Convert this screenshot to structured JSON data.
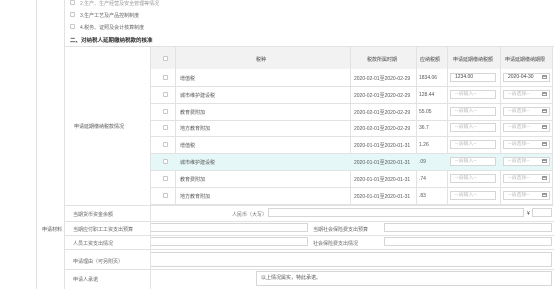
{
  "checklist": [
    {
      "label": "2.生产、生产经营及安全管理等情况",
      "checked": false
    },
    {
      "label": "3.生产工艺及产品控制制度",
      "checked": false
    },
    {
      "label": "4.税务、证照及会计核算制度",
      "checked": false
    }
  ],
  "section2_title": "二、对纳税人延期缴纳税款的核准",
  "apply_label": "申请延期缴纳税款情况",
  "table_headers": {
    "tax_item": "税种",
    "period": "税款所属时期",
    "payable": "应纳税额",
    "apply_amount": "申请延期缴纳税额",
    "apply_deadline": "申请延期缴纳期限"
  },
  "rows": [
    {
      "tax": "增值税",
      "period": "2020-02-01至2020-02-29",
      "amount": "1834.06",
      "apply_amount": "1234.00",
      "deadline": "2020-04-30",
      "highlight": false
    },
    {
      "tax": "城市维护建设税",
      "period": "2020-02-01至2020-02-29",
      "amount": "128.44",
      "apply_amount": "--请输入--",
      "deadline": "--请选择--",
      "highlight": false
    },
    {
      "tax": "教育费附加",
      "period": "2020-02-01至2020-02-29",
      "amount": "55.05",
      "apply_amount": "--请输入--",
      "deadline": "--请选择--",
      "highlight": false
    },
    {
      "tax": "地方教育附加",
      "period": "2020-02-01至2020-02-29",
      "amount": "36.7",
      "apply_amount": "--请输入--",
      "deadline": "--请选择--",
      "highlight": false
    },
    {
      "tax": "增值税",
      "period": "2020-01-01至2020-01-31",
      "amount": "1.26",
      "apply_amount": "--请输入--",
      "deadline": "--请选择--",
      "highlight": false
    },
    {
      "tax": "城市维护建设税",
      "period": "2020-01-01至2020-01-31",
      "amount": ".09",
      "apply_amount": "--请输入--",
      "deadline": "--请选择--",
      "highlight": true
    },
    {
      "tax": "教育费附加",
      "period": "2020-01-01至2020-01-31",
      "amount": ".74",
      "apply_amount": "--请输入--",
      "deadline": "--请选择--",
      "highlight": false
    },
    {
      "tax": "地方教育附加",
      "period": "2020-01-01至2020-01-31",
      "amount": ".83",
      "apply_amount": "--请输入--",
      "deadline": "--请选择--",
      "highlight": false
    }
  ],
  "materials_label": "申请材料",
  "fields": {
    "month_end_balance": "当期货币资金余额",
    "currency_prefix": "人民币（大写）",
    "yen_symbol": "¥",
    "payroll_due": "当期应付职工工资支出预算",
    "social_due": "当期社会保险费支出预算",
    "payroll_actual": "人员工资支出情况",
    "social_actual": "社会保险费支出情况",
    "reason": "申请理由（可另附页）",
    "commitment": "申请人承诺",
    "commitment_text": "以上情况属实，特此承诺。"
  },
  "colors": {
    "highlight": "#e6f7f7",
    "header_bg": "#f2f2f2",
    "border": "#e2e2e2"
  },
  "icons": {
    "calendar": "calendar-icon",
    "checkbox": "checkbox"
  }
}
